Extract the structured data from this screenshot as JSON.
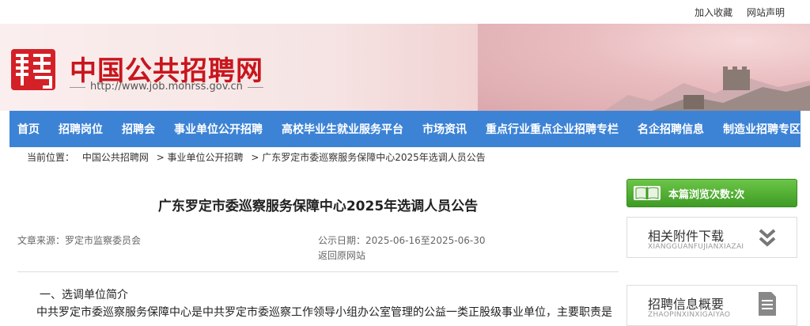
{
  "top_links": [
    "加入收藏",
    "网站声明"
  ],
  "site": {
    "title": "中国公共招聘网",
    "url": "http://www.job.mohrss.gov.cn",
    "accent": "#c8161d"
  },
  "nav": {
    "items": [
      "首页",
      "招聘岗位",
      "招聘会",
      "事业单位公开招聘",
      "高校毕业生就业服务平台",
      "市场资讯",
      "重点行业重点企业招聘专栏",
      "名企招聘信息",
      "制造业招聘专区"
    ],
    "color": "#3d83d5"
  },
  "breadcrumb": {
    "label": "当前位置：",
    "items": [
      "中国公共招聘网",
      "> 事业单位公开招聘",
      "> 广东罗定市委巡察服务保障中心2025年选调人员公告"
    ]
  },
  "article": {
    "title": "广东罗定市委巡察服务保障中心2025年选调人员公告",
    "source": "文章来源：罗定市监察委员会",
    "date": "公示日期：2025-06-16至2025-06-30",
    "original_link": "返回原网站",
    "section_heading": "一、选调单位简介",
    "paragraph": "中共罗定市委巡察服务保障中心是中共罗定市委巡察工作领导小组办公室管理的公益一类正股级事业单位，主要职责是"
  },
  "sidebar": {
    "views_label": "本篇浏览次数:次",
    "views_color": "#4caf32",
    "box1": {
      "title": "相关附件下载",
      "subtitle": "XIANGGUANFUJIANXIAZAI",
      "icon": "double-chevron-down-icon"
    },
    "box2": {
      "title": "招聘信息概要",
      "subtitle": "ZHAOPINXINXIGAIYAO",
      "icon": "document-icon"
    }
  }
}
